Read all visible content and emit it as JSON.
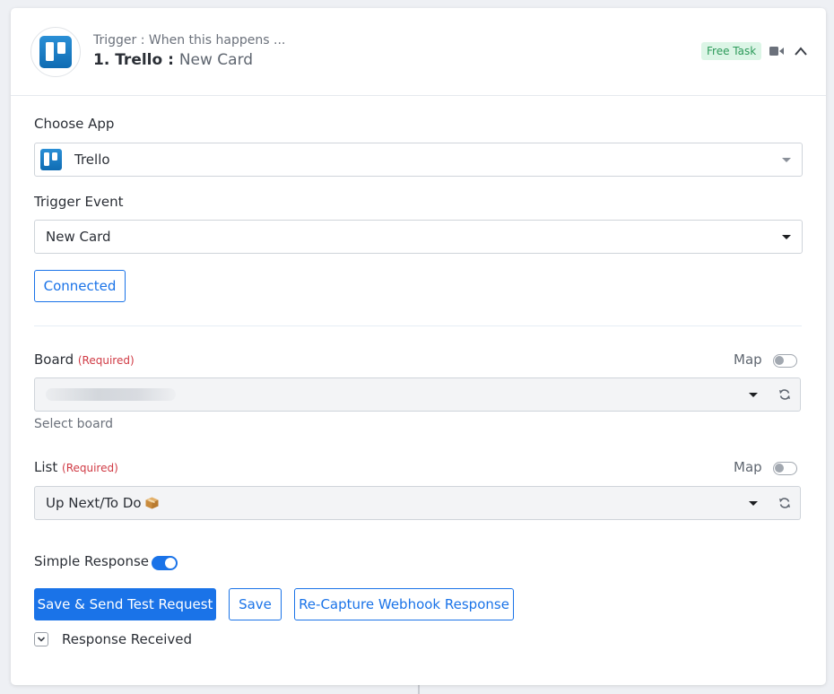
{
  "header": {
    "subtitle": "Trigger : When this happens ...",
    "step_app": "1. Trello :",
    "step_event": "New Card",
    "badge": "Free Task",
    "icons": [
      "trello-logo",
      "video-icon",
      "chevron-up-icon"
    ]
  },
  "choose_app": {
    "label": "Choose App",
    "value": "Trello"
  },
  "trigger_event": {
    "label": "Trigger Event",
    "value": "New Card"
  },
  "connection": {
    "button_label": "Connected"
  },
  "board": {
    "label": "Board",
    "required": "(Required)",
    "map_label": "Map",
    "help": "Select board"
  },
  "list": {
    "label": "List",
    "required": "(Required)",
    "map_label": "Map",
    "value": "Up Next/To Do"
  },
  "simple_response": {
    "label": "Simple Response"
  },
  "actions": {
    "save_send": "Save & Send Test Request",
    "save": "Save",
    "recapture": "Re-Capture Webhook Response"
  },
  "response": {
    "label": "Response Received"
  },
  "colors": {
    "primary": "#1a73e8",
    "required": "#d03a44",
    "badge_bg": "#dcf5e6",
    "badge_text": "#2d9a5a"
  }
}
